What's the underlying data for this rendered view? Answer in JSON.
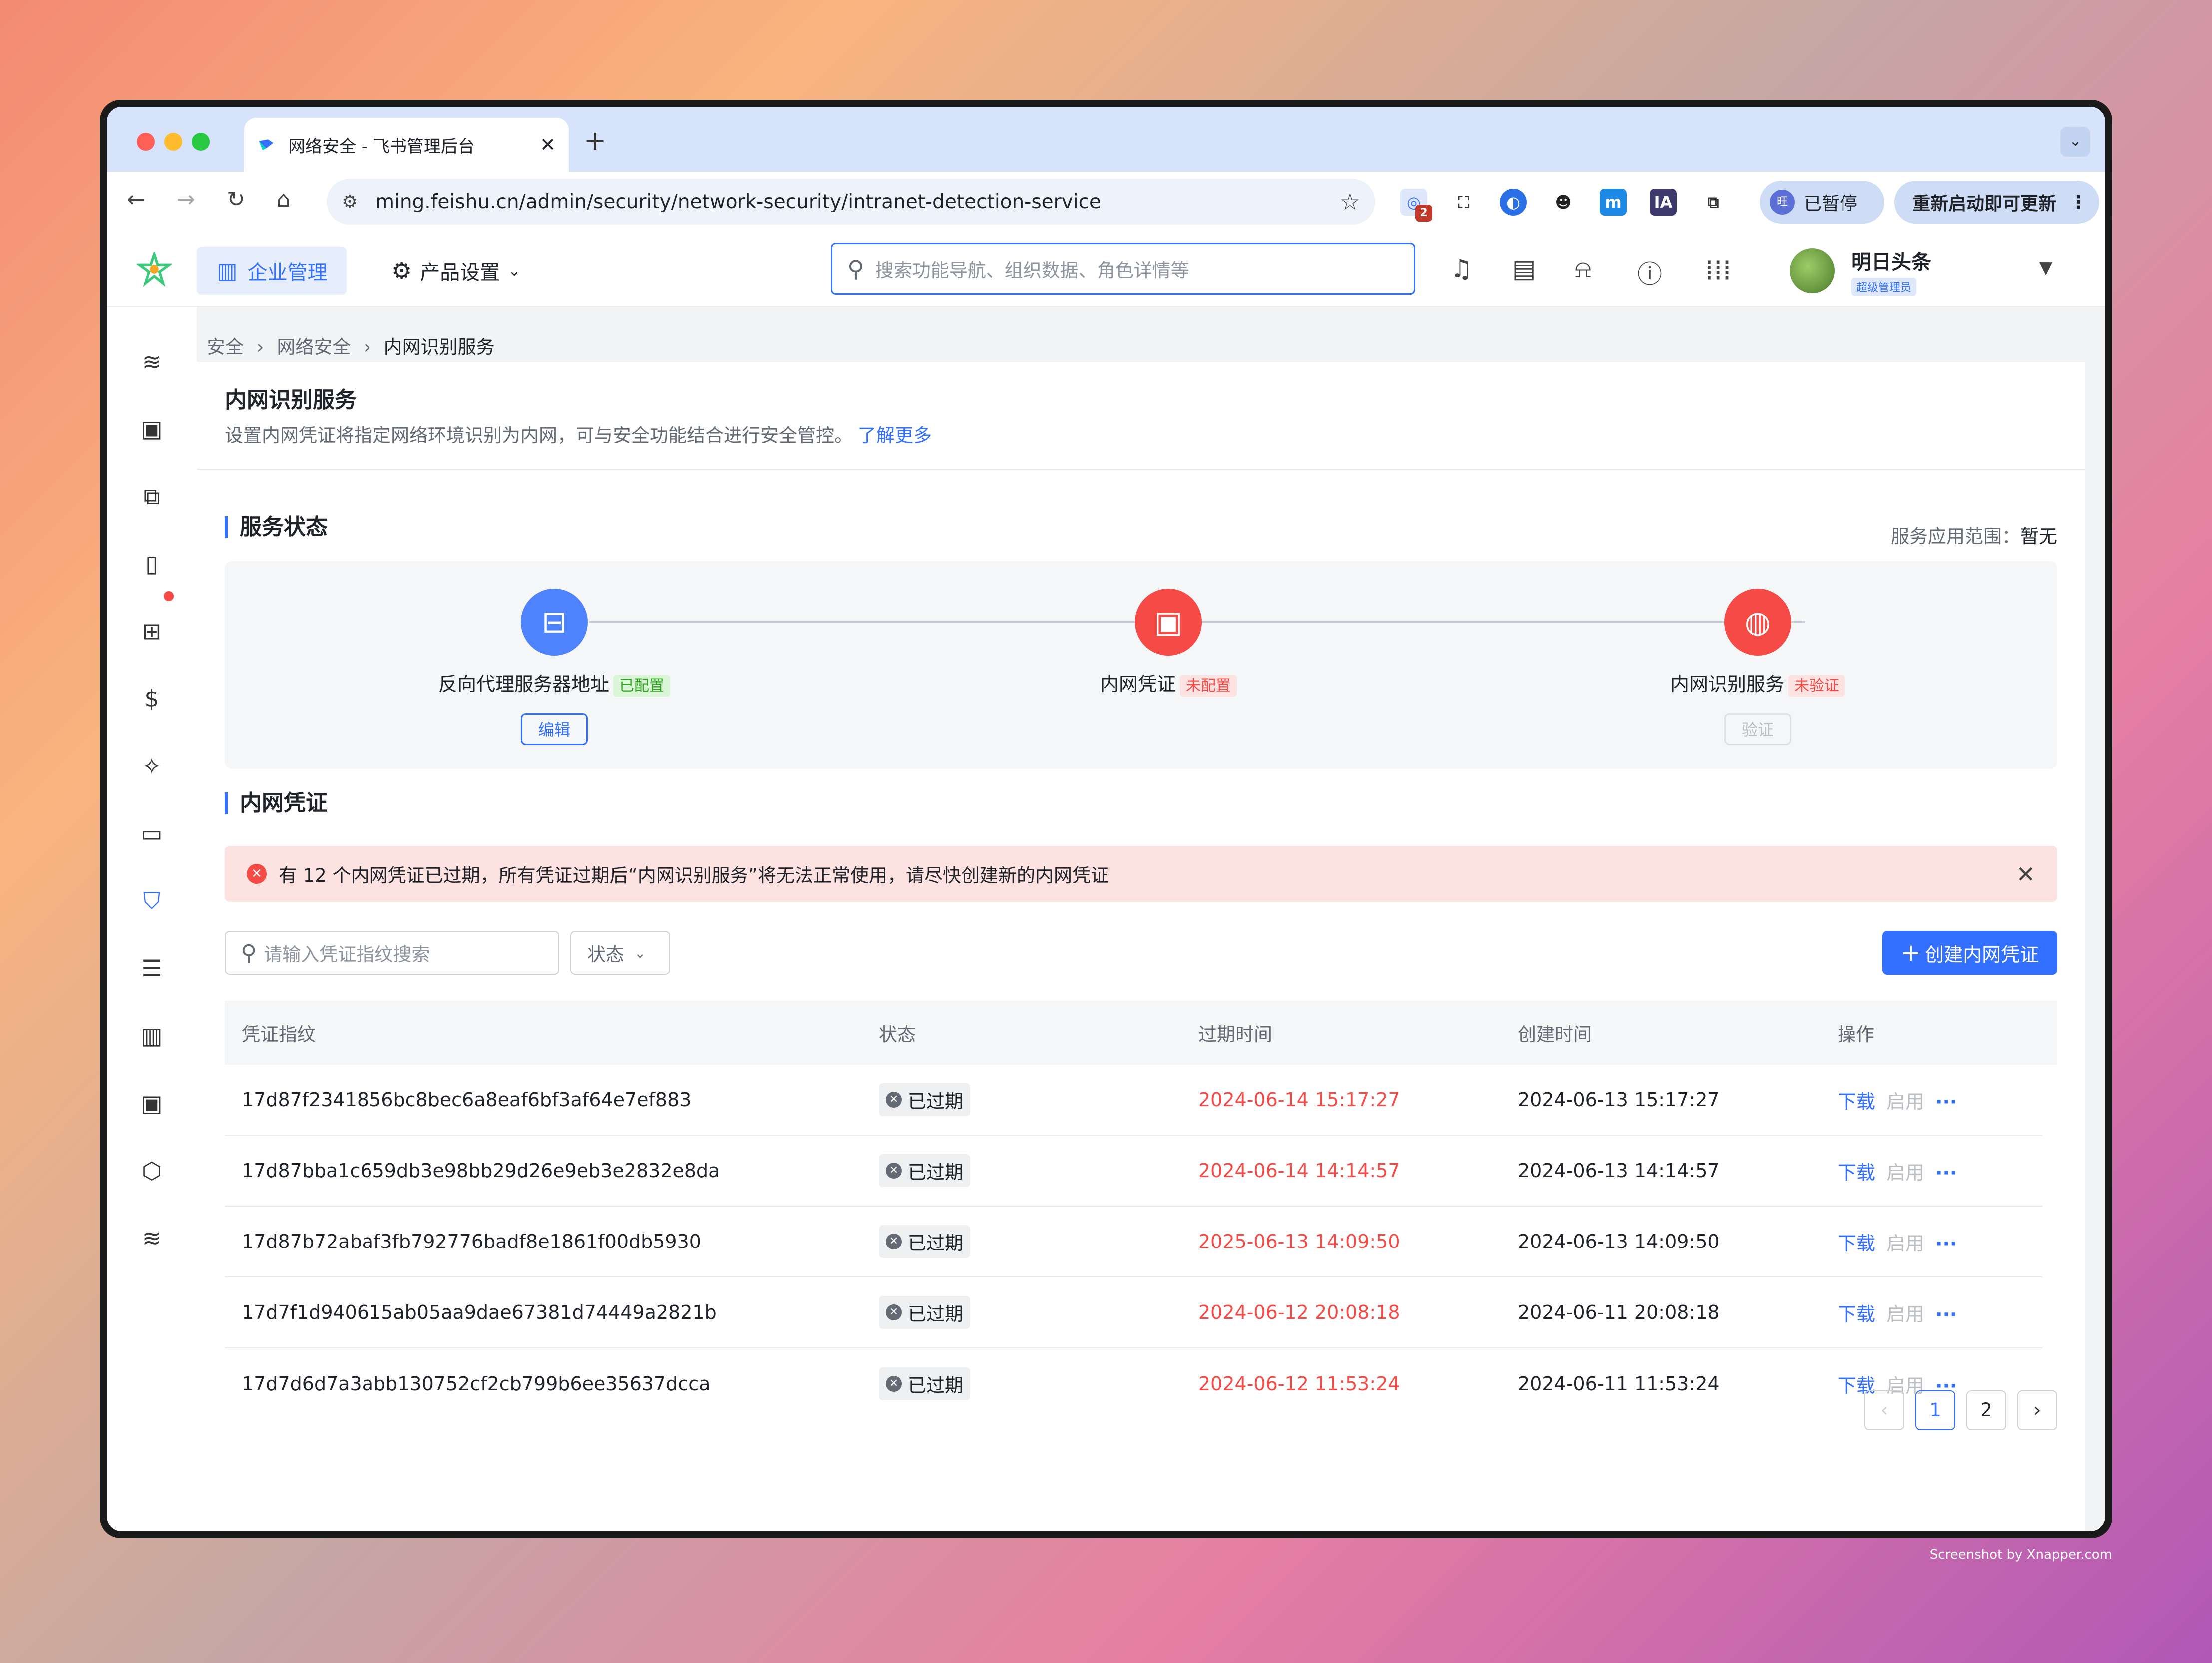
{
  "browser": {
    "tab_title": "网络安全 - 飞书管理后台",
    "tab_close": "✕",
    "new_tab": "+",
    "url": "ming.feishu.cn/admin/security/network-security/intranet-detection-service",
    "ext_badge": "2",
    "paused_label": "已暂停",
    "paused_avatar": "旺",
    "update_label": "重新启动即可更新",
    "update_more": "⋮"
  },
  "header": {
    "enterprise_mgmt": "企业管理",
    "product_settings": "产品设置",
    "search_placeholder": "搜索功能导航、组织数据、角色详情等",
    "user_name": "明日头条",
    "user_role": "超级管理员"
  },
  "breadcrumb": {
    "l1": "安全",
    "l2": "网络安全",
    "l3": "内网识别服务",
    "sep": "›"
  },
  "page": {
    "title": "内网识别服务",
    "desc": "设置内网凭证将指定网络环境识别为内网，可与安全功能结合进行安全管控。",
    "learn_more": "了解更多"
  },
  "service_status": {
    "title": "服务状态",
    "scope_label": "服务应用范围：",
    "scope_value": "暂无",
    "steps": [
      {
        "label": "反向代理服务器地址",
        "tag": "已配置",
        "button": "编辑",
        "color": "#4e83fd",
        "status": "ok"
      },
      {
        "label": "内网凭证",
        "tag": "未配置",
        "button": "",
        "color": "#f54a45",
        "status": "bad"
      },
      {
        "label": "内网识别服务",
        "tag": "未验证",
        "button": "验证",
        "color": "#f54a45",
        "status": "bad"
      }
    ]
  },
  "credentials": {
    "title": "内网凭证",
    "alert": "有 12 个内网凭证已过期，所有凭证过期后“内网识别服务”将无法正常使用，请尽快创建新的内网凭证",
    "search_placeholder": "请输入凭证指纹搜索",
    "status_filter": "状态",
    "create_button": "创建内网凭证",
    "columns": [
      "凭证指纹",
      "状态",
      "过期时间",
      "创建时间",
      "操作"
    ],
    "rows": [
      {
        "fingerprint": "17d87f2341856bc8bec6a8eaf6bf3af64e7ef883",
        "status": "已过期",
        "expire": "2024-06-14 15:17:27",
        "created": "2024-06-13 15:17:27"
      },
      {
        "fingerprint": "17d87bba1c659db3e98bb29d26e9eb3e2832e8da",
        "status": "已过期",
        "expire": "2024-06-14 14:14:57",
        "created": "2024-06-13 14:14:57"
      },
      {
        "fingerprint": "17d87b72abaf3fb792776badf8e1861f00db5930",
        "status": "已过期",
        "expire": "2025-06-13 14:09:50",
        "created": "2024-06-13 14:09:50"
      },
      {
        "fingerprint": "17d7f1d940615ab05aa9dae67381d74449a2821b",
        "status": "已过期",
        "expire": "2024-06-12 20:08:18",
        "created": "2024-06-11 20:08:18"
      },
      {
        "fingerprint": "17d7d6d7a3abb130752cf2cb799b6ee35637dcca",
        "status": "已过期",
        "expire": "2024-06-12 11:53:24",
        "created": "2024-06-11 11:53:24"
      }
    ],
    "actions": {
      "download": "下载",
      "enable": "启用",
      "more": "···"
    }
  },
  "pagination": {
    "prev": "‹",
    "pages": [
      "1",
      "2"
    ],
    "next": "›",
    "current": "1"
  },
  "credit": "Screenshot by Xnapper.com"
}
